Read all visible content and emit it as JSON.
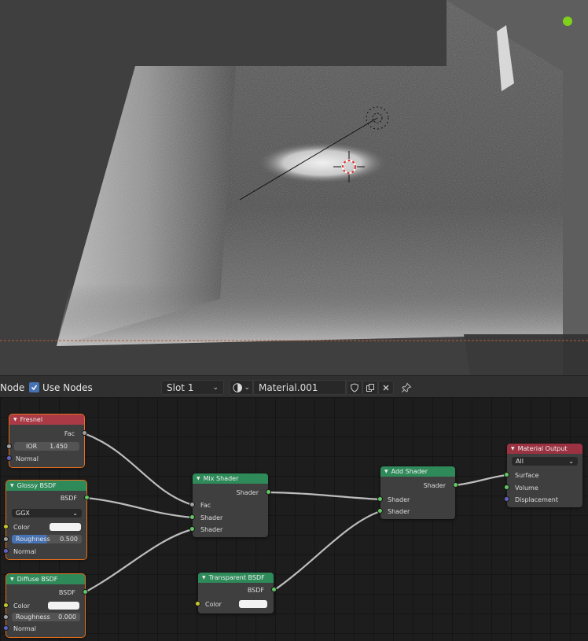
{
  "header": {
    "editor_label": "Node",
    "use_nodes_label": "Use Nodes",
    "use_nodes_checked": true,
    "slot_value": "Slot 1",
    "material_name": "Material.001"
  },
  "nodes": {
    "fresnel": {
      "title": "Fresnel",
      "output_fac": "Fac",
      "ior_label": "IOR",
      "ior_value": "1.450",
      "normal_label": "Normal"
    },
    "glossy": {
      "title": "Glossy BSDF",
      "output_bsdf": "BSDF",
      "distribution": "GGX",
      "color_label": "Color",
      "roughness_label": "Roughness",
      "roughness_value": "0.500",
      "normal_label": "Normal"
    },
    "diffuse": {
      "title": "Diffuse BSDF",
      "output_bsdf": "BSDF",
      "color_label": "Color",
      "roughness_label": "Roughness",
      "roughness_value": "0.000",
      "normal_label": "Normal"
    },
    "mix": {
      "title": "Mix Shader",
      "output_shader": "Shader",
      "input_fac": "Fac",
      "input_shader1": "Shader",
      "input_shader2": "Shader"
    },
    "add": {
      "title": "Add Shader",
      "output_shader": "Shader",
      "input_shader1": "Shader",
      "input_shader2": "Shader"
    },
    "transparent": {
      "title": "Transparent BSDF",
      "output_bsdf": "BSDF",
      "color_label": "Color"
    },
    "output": {
      "title": "Material Output",
      "target": "All",
      "surface_label": "Surface",
      "volume_label": "Volume",
      "displacement_label": "Displacement"
    }
  },
  "colors": {
    "input_header": "#a93a46",
    "shader_header": "#2f8a5a",
    "output_header": "#9b3242",
    "selection_outline": "#e86f1a",
    "checkbox": "#4772b3",
    "gizmo_dot": "#7fd11a"
  }
}
